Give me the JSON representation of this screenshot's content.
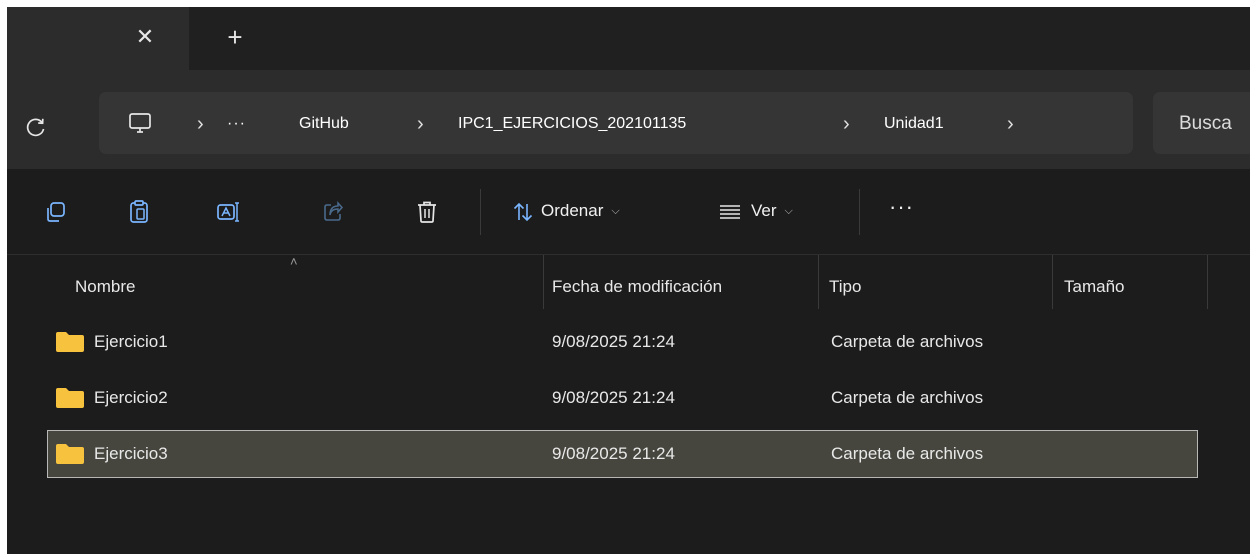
{
  "tabs": {
    "close_glyph": "✕",
    "new_tab_glyph": "+"
  },
  "address_bar": {
    "overflow": "···",
    "crumbs": [
      "GitHub",
      "IPC1_EJERCICIOS_202101135",
      "Unidad1"
    ],
    "separator": "›"
  },
  "search": {
    "placeholder": "Busca"
  },
  "toolbar": {
    "sort_label": "Ordenar",
    "view_label": "Ver",
    "more_label": "···"
  },
  "columns": {
    "name": "Nombre",
    "date": "Fecha de modificación",
    "type": "Tipo",
    "size": "Tamaño"
  },
  "files": [
    {
      "name": "Ejercicio1",
      "date": "9/08/2025 21:24",
      "type": "Carpeta de archivos",
      "selected": false
    },
    {
      "name": "Ejercicio2",
      "date": "9/08/2025 21:24",
      "type": "Carpeta de archivos",
      "selected": false
    },
    {
      "name": "Ejercicio3",
      "date": "9/08/2025 21:24",
      "type": "Carpeta de archivos",
      "selected": true
    }
  ],
  "colors": {
    "window_bg": "#1c1c1c",
    "folder": "#f7c23e",
    "selection_bg": "#46463f"
  }
}
